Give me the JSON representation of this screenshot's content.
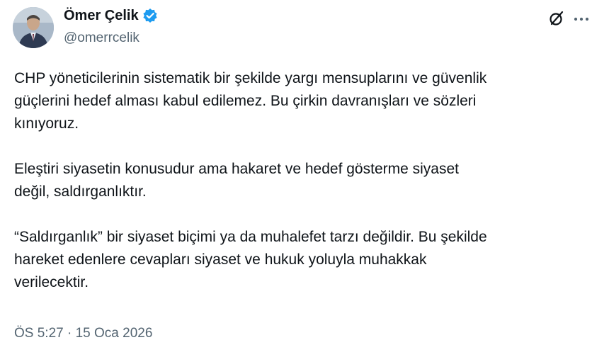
{
  "author": {
    "display_name": "Ömer Çelik",
    "handle": "@omerrcelik",
    "verified": true
  },
  "tweet": {
    "paragraphs": [
      "CHP yöneticilerinin sistematik bir şekilde yargı mensuplarını ve güvenlik\ngüçlerini hedef alması kabul edilemez. Bu çirkin davranışları ve sözleri\nkınıyoruz.",
      "Eleştiri siyasetin konusudur ama hakaret ve hedef gösterme siyaset\ndeğil, saldırganlıktır.",
      "“Saldırganlık” bir siyaset biçimi ya da muhalefet tarzı değildir. Bu şekilde\nhareket edenlere cevapları siyaset ve hukuk yoluyla muhakkak\nverilecektir."
    ],
    "time": "ÖS 5:27",
    "separator": "·",
    "date": "15 Oca 2026"
  },
  "icons": {
    "verified": "verified-badge-icon",
    "grok": "grok-icon",
    "more": "more-options-icon"
  },
  "colors": {
    "text_primary": "#0f1419",
    "text_secondary": "#536471",
    "verified_blue": "#1d9bf0"
  }
}
